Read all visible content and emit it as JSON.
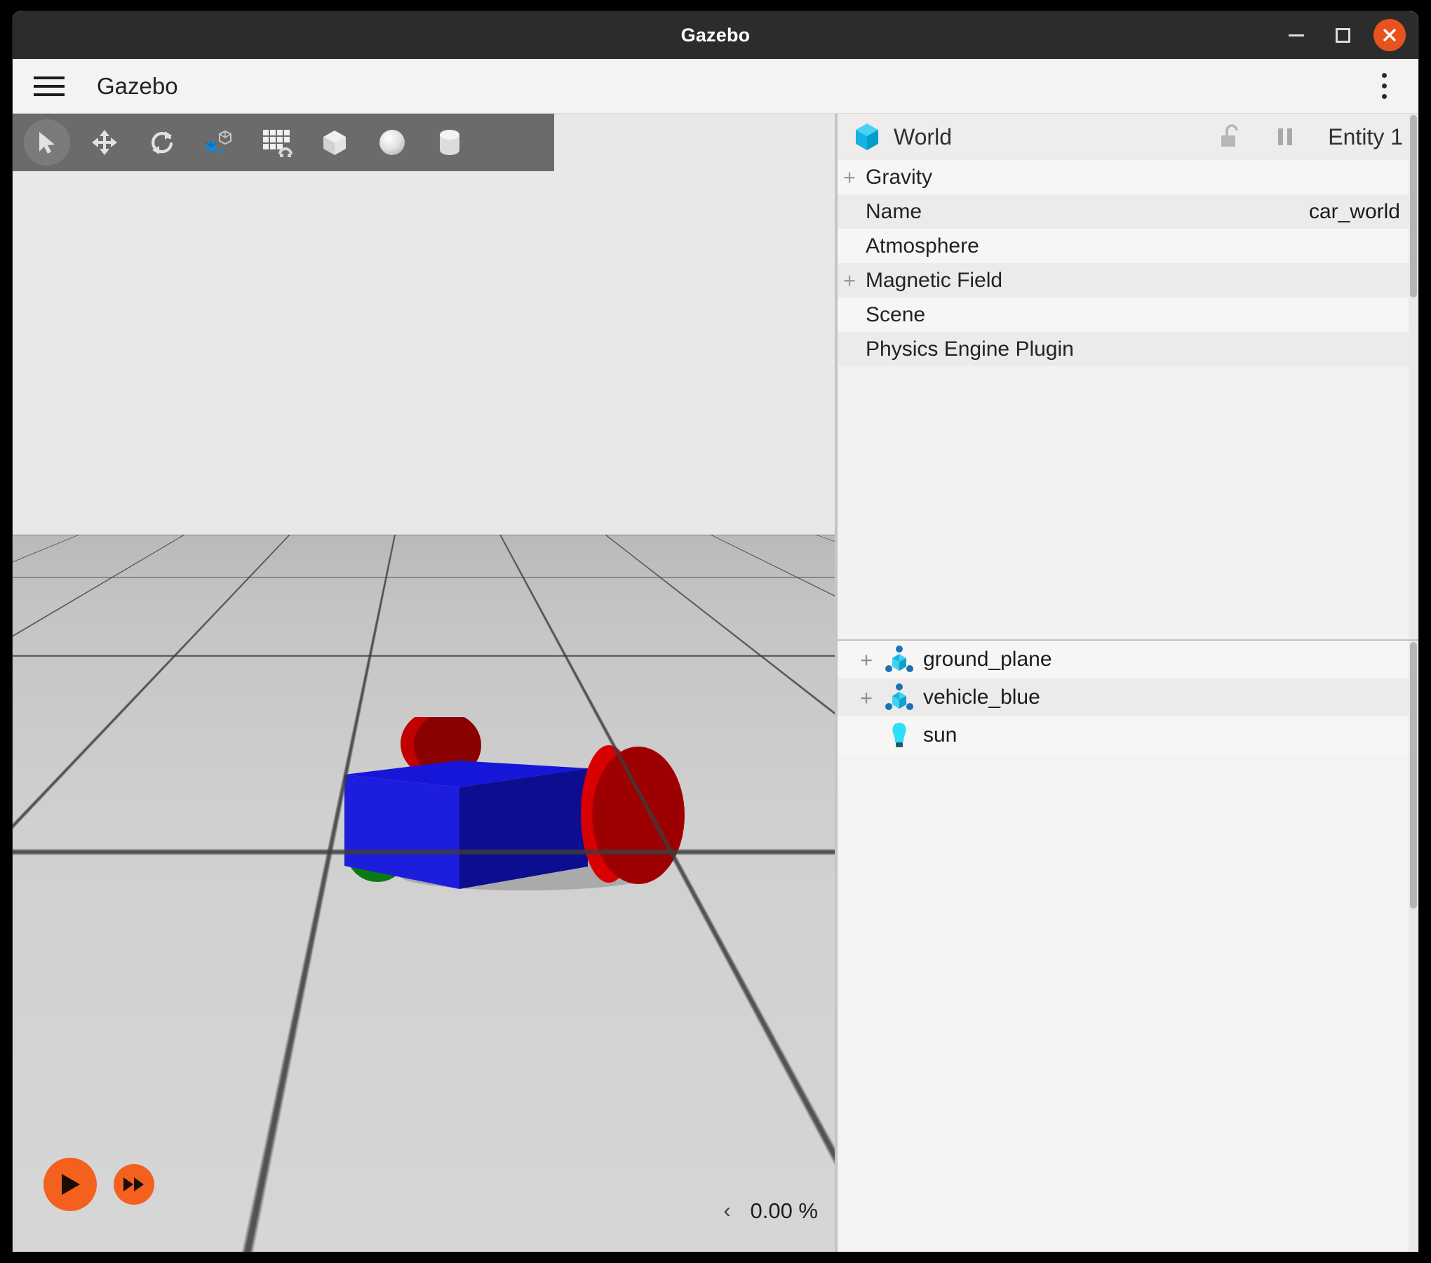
{
  "window": {
    "title": "Gazebo",
    "controls": {
      "minimize": "minimize",
      "maximize": "maximize",
      "close": "close"
    }
  },
  "header": {
    "menu_icon": "hamburger-menu-icon",
    "app_title": "Gazebo",
    "overflow_icon": "kebab-menu-icon"
  },
  "toolbar": {
    "items": [
      {
        "icon": "select-arrow-icon",
        "label": "Select",
        "active": true
      },
      {
        "icon": "translate-icon",
        "label": "Translate",
        "active": false
      },
      {
        "icon": "rotate-icon",
        "label": "Rotate",
        "active": false
      },
      {
        "icon": "transform-control-icon",
        "label": "Transform Control",
        "active": false
      },
      {
        "icon": "grid-snap-icon",
        "label": "Snap to Grid",
        "active": false
      },
      {
        "icon": "box-shape-icon",
        "label": "Box",
        "active": false
      },
      {
        "icon": "sphere-shape-icon",
        "label": "Sphere",
        "active": false
      },
      {
        "icon": "cylinder-shape-icon",
        "label": "Cylinder",
        "active": false
      }
    ]
  },
  "viewport": {
    "play_icon": "play-icon",
    "step_icon": "fast-forward-icon",
    "collapse_icon": "chevron-left-icon",
    "collapse_glyph": "‹",
    "realtime_factor": "0.00 %",
    "scene": {
      "sky_color": "#e8e8e8",
      "ground_color": "#d2d2d2",
      "grid_line_color": "#3c3c3c",
      "models": [
        {
          "name": "chassis",
          "shape": "box",
          "color": "#1414d2"
        },
        {
          "name": "left-wheel",
          "shape": "cylinder",
          "color": "#d40000"
        },
        {
          "name": "right-wheel",
          "shape": "cylinder",
          "color": "#d40000"
        },
        {
          "name": "caster",
          "shape": "sphere",
          "color": "#0a8a0a"
        }
      ]
    }
  },
  "inspector": {
    "icon": "world-cube-icon",
    "title": "World",
    "lock_icon": "unlock-icon",
    "pause_icon": "pause-icon",
    "entity_label": "Entity 1",
    "properties": [
      {
        "expandable": true,
        "expander": "+",
        "label": "Gravity",
        "value": ""
      },
      {
        "expandable": false,
        "expander": "",
        "label": "Name",
        "value": "car_world"
      },
      {
        "expandable": false,
        "expander": "",
        "label": "Atmosphere",
        "value": ""
      },
      {
        "expandable": true,
        "expander": "+",
        "label": "Magnetic Field",
        "value": ""
      },
      {
        "expandable": false,
        "expander": "",
        "label": "Scene",
        "value": ""
      },
      {
        "expandable": false,
        "expander": "",
        "label": "Physics Engine Plugin",
        "value": ""
      }
    ]
  },
  "entity_tree": {
    "items": [
      {
        "expander": "+",
        "icon": "model-tree-icon",
        "label": "ground_plane"
      },
      {
        "expander": "+",
        "icon": "model-tree-icon",
        "label": "vehicle_blue"
      },
      {
        "expander": "",
        "icon": "light-bulb-icon",
        "label": "sun"
      }
    ]
  },
  "colors": {
    "accent_orange": "#f4601e",
    "titlebar": "#2c2c2c",
    "panel_bg": "#f2f1f0",
    "toolbar_overlay": "#616161",
    "model_icon_cyan": "#2ec5e8",
    "light_icon_cyan": "#23d6ef"
  }
}
